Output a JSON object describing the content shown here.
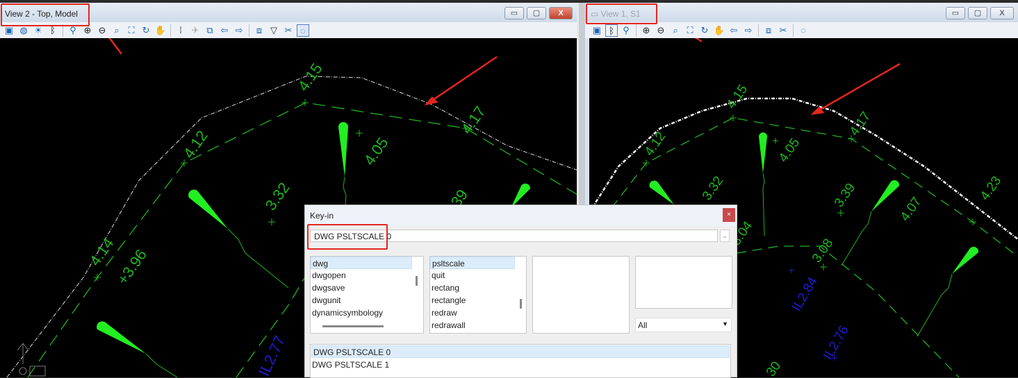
{
  "left_view": {
    "title": "View 2 - Top, Model",
    "toolbar_icons": [
      "view-attributes-icon",
      "display-style-icon",
      "lighting-icon",
      "bentley-icon",
      "brush-icon",
      "zoom-in-icon",
      "zoom-out-icon",
      "window-area-icon",
      "fit-view-icon",
      "rotate-view-icon",
      "pan-icon",
      "walk-icon",
      "fly-icon",
      "copy-view-icon",
      "previous-view-icon",
      "next-view-icon",
      "view-toggle-icon",
      "clip-volume-icon",
      "clip-mask-icon",
      "camera-icon"
    ],
    "labels": {
      "l415": "4.15",
      "l417": "4.17",
      "l412": "4.12",
      "l405": "4.05",
      "l332": "3.32",
      "l414": "4.14",
      "l396": "+3.96",
      "l39": "39",
      "il277": "IL2.77"
    }
  },
  "right_view": {
    "title": "View 1, S1",
    "labels": {
      "l415": "4.15",
      "l417": "4.17",
      "l412": "4.12",
      "l405": "4.05",
      "l332": "3.32",
      "l339": "3.39",
      "l407": "4.07",
      "l423": "4.23",
      "l304": "3.04",
      "l308": "3.08",
      "il284": "IL2.84",
      "il276": "IL2.76",
      "l30": "30"
    }
  },
  "window_buttons": {
    "minimize": "▭",
    "maximize": "▢",
    "close": "X"
  },
  "keyin": {
    "title": "Key-in",
    "close": "×",
    "input_value": "DWG PSLTSCALE 0",
    "dropdown": "⌄",
    "list1": [
      "dwg",
      "dwgopen",
      "dwgsave",
      "dwgunit",
      "dynamicsymbology"
    ],
    "list2": [
      "psltscale",
      "quit",
      "rectang",
      "rectangle",
      "redraw",
      "redrawall"
    ],
    "filter": "All",
    "history": [
      "DWG PSLTSCALE 0",
      "DWG PSLTSCALE 1"
    ]
  },
  "colors": {
    "green": "#1fb31f",
    "cone": "#22ee22",
    "blue": "#1c1cd6",
    "highlight": "#e3261f"
  }
}
